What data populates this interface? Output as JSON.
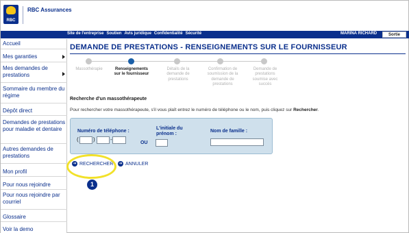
{
  "brand": {
    "name": "RBC Assurances",
    "logo_text": "RBC"
  },
  "topnav": {
    "links": [
      "Site de l'entreprise",
      "Soutien",
      "Avis juridique",
      "Confidentialité",
      "Sécurité"
    ],
    "user": "MARINA RICHARD",
    "logout": "Sortie"
  },
  "sidebar": {
    "items": [
      {
        "label": "Accueil"
      },
      {
        "label": "Mes garanties"
      },
      {
        "label": "Mes demandes de prestations"
      },
      {
        "label": "Sommaire du membre du régime"
      },
      {
        "label": "Dépôt direct"
      },
      {
        "label": "Demandes de prestations pour maladie et dentaire"
      },
      {
        "label": "Autres demandes de prestations"
      },
      {
        "label": "Mon profil"
      },
      {
        "label": "Pour nous rejoindre"
      },
      {
        "label": "Pour nous rejoindre par courriel"
      },
      {
        "label": "Glossaire"
      },
      {
        "label": "Voir la demo"
      }
    ]
  },
  "main": {
    "title": "DEMANDE DE PRESTATIONS - RENSEIGNEMENTS SUR LE FOURNISSEUR",
    "steps": [
      {
        "label": "Massothérapie",
        "state": "done"
      },
      {
        "label": "Renseignements sur le fournisseur",
        "state": "active"
      },
      {
        "label": "Détails de la demande de prestations",
        "state": "pending"
      },
      {
        "label": "Confirmation de soumission de la demande de prestations",
        "state": "pending"
      },
      {
        "label": "Demande de prestations soumise avec succès",
        "state": "pending"
      }
    ],
    "section_title": "Recherche d'un massothérapeute",
    "intro_text": "Pour rechercher votre massothérapeute, s'il vous plaît entrez le numéro de téléphone ou le nom, puis cliquez sur ",
    "intro_bold": "Rechercher",
    "form": {
      "phone_label": "Numéro de téléphone :",
      "phone_open": "(",
      "phone_close": ")",
      "phone_dash": "-",
      "or_label": "OU",
      "initial_label": "L'initiale du prénom :",
      "lastname_label": "Nom de famille :",
      "phone_area": "",
      "phone_prefix": "",
      "phone_line": "",
      "initial": "",
      "lastname": ""
    },
    "buttons": {
      "search": "RECHERCHER",
      "cancel": "ANNULER"
    },
    "callout_number": "1"
  },
  "colors": {
    "brand_blue": "#0a2f8c",
    "active_step": "#1a5fa8",
    "highlight": "#f2e12a",
    "form_bg": "#cfe0ec"
  }
}
